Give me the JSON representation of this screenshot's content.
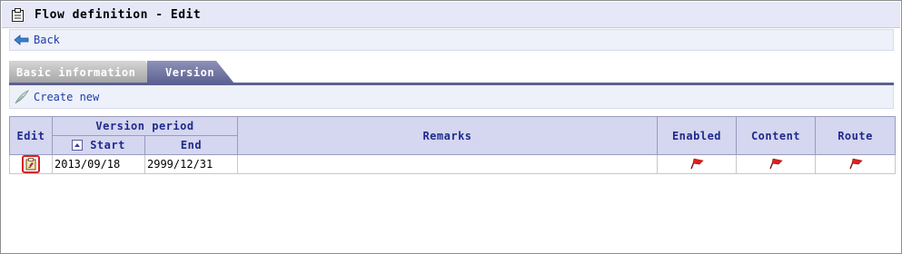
{
  "window": {
    "title": "Flow definition - Edit"
  },
  "nav": {
    "back_label": "Back"
  },
  "tabs": [
    {
      "label": "Basic information",
      "active": false
    },
    {
      "label": "Version",
      "active": true
    }
  ],
  "toolbar": {
    "create_label": "Create new"
  },
  "table": {
    "headers": {
      "edit": "Edit",
      "version_period": "Version period",
      "start": "Start",
      "end": "End",
      "remarks": "Remarks",
      "enabled": "Enabled",
      "content": "Content",
      "route": "Route"
    },
    "rows": [
      {
        "start": "2013/09/18",
        "end": "2999/12/31",
        "remarks": "",
        "enabled_icon": "red-flag-icon",
        "content_icon": "red-flag-icon",
        "route_icon": "red-flag-icon"
      }
    ]
  },
  "colors": {
    "header_bg": "#d5d6ef",
    "header_text": "#1e2a8c",
    "tab_active": "#5c6192",
    "link": "#1e3ea8",
    "flag": "#e02020",
    "highlight": "#d81f1f"
  }
}
